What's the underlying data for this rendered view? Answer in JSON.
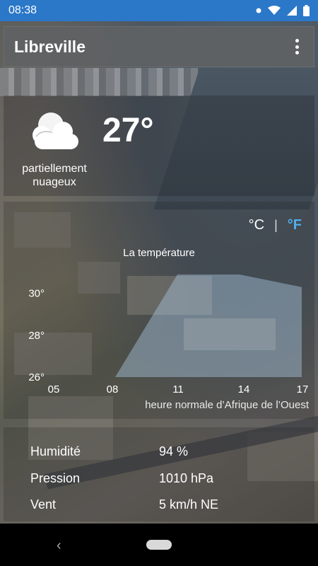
{
  "status_bar": {
    "time": "08:38"
  },
  "app_bar": {
    "title": "Libreville",
    "menu_icon": "more-vert-icon"
  },
  "current": {
    "temperature": "27°",
    "condition": "partiellement nuageux",
    "icon": "partly-cloudy-icon"
  },
  "units": {
    "celsius": "°C",
    "separator": "|",
    "fahrenheit": "°F",
    "selected": "fahrenheit",
    "selected_color": "#4fb0ec"
  },
  "chart": {
    "caption": "heure normale d’Afrique de l’Ouest"
  },
  "chart_data": {
    "type": "area",
    "title": "La température",
    "x_ticks": [
      "05",
      "08",
      "11",
      "14",
      "17"
    ],
    "y_ticks": [
      "26°",
      "28°",
      "30°"
    ],
    "x": [
      5,
      8,
      11,
      14,
      17
    ],
    "values": [
      null,
      26.0,
      30.9,
      30.9,
      30.3
    ],
    "ylim": [
      26,
      31
    ],
    "xlim": [
      5,
      17
    ],
    "grid": false,
    "fill_color": "#a9c6dd"
  },
  "details": {
    "humidity_label": "Humidité",
    "humidity_value": "94 %",
    "pressure_label": "Pression",
    "pressure_value": "1010 hPa",
    "wind_label": "Vent",
    "wind_value": "5 km/h NE"
  }
}
